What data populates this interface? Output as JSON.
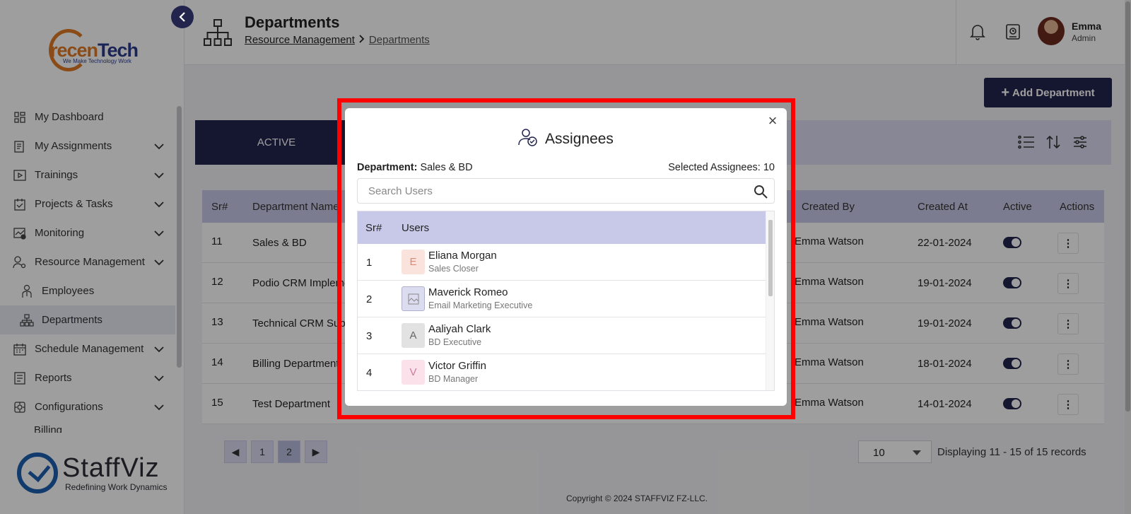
{
  "sidebar": {
    "logo_main": "recen",
    "logo_accent": "Tech",
    "logo_tagline": "We Make Technology Work",
    "items": [
      {
        "label": "My Dashboard"
      },
      {
        "label": "My Assignments"
      },
      {
        "label": "Trainings"
      },
      {
        "label": "Projects & Tasks"
      },
      {
        "label": "Monitoring"
      },
      {
        "label": "Resource Management"
      },
      {
        "label": "Employees"
      },
      {
        "label": "Departments"
      },
      {
        "label": "Schedule Management"
      },
      {
        "label": "Reports"
      },
      {
        "label": "Configurations"
      }
    ],
    "partial_item": "Billing",
    "brand_name": "StaffViz",
    "brand_tagline": "Redefining Work Dynamics"
  },
  "header": {
    "title": "Departments",
    "breadcrumb": [
      "Resource Management",
      "Departments"
    ],
    "user_name": "Emma",
    "user_role": "Admin"
  },
  "main": {
    "add_button": "Add Department",
    "active_tab": "ACTIVE",
    "columns": [
      "Sr#",
      "Department Name",
      "Created By",
      "Created At",
      "Active",
      "Actions"
    ],
    "rows": [
      {
        "sr": "11",
        "name": "Sales & BD",
        "created_by": "Emma Watson",
        "created_at": "22-01-2024"
      },
      {
        "sr": "12",
        "name": "Podio CRM Impleme",
        "created_by": "Emma Watson",
        "created_at": "19-01-2024"
      },
      {
        "sr": "13",
        "name": "Technical CRM Sup",
        "created_by": "Emma Watson",
        "created_at": "19-01-2024"
      },
      {
        "sr": "14",
        "name": "Billing Department",
        "created_by": "Emma Watson",
        "created_at": "18-01-2024"
      },
      {
        "sr": "15",
        "name": "Test Department",
        "created_by": "Emma Watson",
        "created_at": "14-01-2024"
      }
    ],
    "pages": [
      "1",
      "2"
    ],
    "per_page": "10",
    "records": "Displaying 11 - 15 of 15 records",
    "copyright": "Copyright © 2024 STAFFVIZ FZ-LLC."
  },
  "modal": {
    "title": "Assignees",
    "dept_label": "Department:",
    "dept_value": "Sales & BD",
    "selected": "Selected Assignees: 10",
    "search_placeholder": "Search Users",
    "columns": [
      "Sr#",
      "Users"
    ],
    "users": [
      {
        "sr": "1",
        "initial": "E",
        "name": "Eliana Morgan",
        "role": "Sales Closer",
        "color": "#fbe3dd",
        "fg": "#d88a75"
      },
      {
        "sr": "2",
        "initial": "",
        "name": "Maverick Romeo",
        "role": "Email Marketing Executive",
        "color": "#dcdcf0",
        "fg": "#666"
      },
      {
        "sr": "3",
        "initial": "A",
        "name": "Aaliyah Clark",
        "role": "BD Executive",
        "color": "#e2e2e2",
        "fg": "#666"
      },
      {
        "sr": "4",
        "initial": "V",
        "name": "Victor Griffin",
        "role": "BD Manager",
        "color": "#fbe1ea",
        "fg": "#cf7aa0"
      }
    ]
  },
  "colors": {
    "primary": "#23244e",
    "highlight": "#ff0000",
    "header_row": "#c8c9e8"
  }
}
